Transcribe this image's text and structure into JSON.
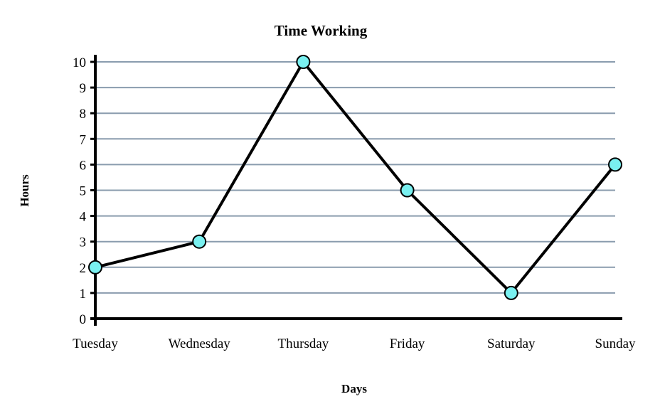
{
  "chart_data": {
    "type": "line",
    "title": "Time Working",
    "xlabel": "Days",
    "ylabel": "Hours",
    "categories": [
      "Tuesday",
      "Wednesday",
      "Thursday",
      "Friday",
      "Saturday",
      "Sunday"
    ],
    "series": [
      {
        "name": "Hours",
        "values": [
          2,
          3,
          10,
          5,
          1,
          6
        ]
      }
    ],
    "ylim": [
      0,
      10
    ],
    "yticks": [
      0,
      1,
      2,
      3,
      4,
      5,
      6,
      7,
      8,
      9,
      10
    ],
    "grid": true,
    "legend": "none",
    "colors": {
      "line": "#000000",
      "marker_fill": "#79f0f0",
      "marker_stroke": "#000000",
      "grid": "#8a9cae",
      "axis": "#000000"
    }
  }
}
